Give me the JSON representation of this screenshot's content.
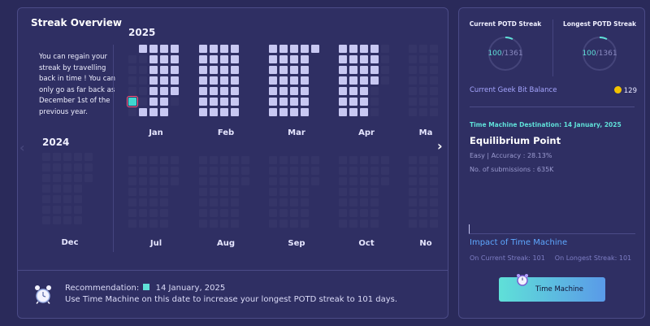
{
  "streak_overview": {
    "title": "Streak Overview",
    "info_text": "You can regain your streak by travelling back in time ! You can only go as far back as December 1st of the previous year.",
    "year_2025": "2025",
    "year_2024": "2024",
    "months_top": [
      "Jan",
      "Feb",
      "Mar",
      "Apr",
      "Ma"
    ],
    "months_bottom": [
      "Jul",
      "Aug",
      "Sep",
      "Oct",
      "No"
    ],
    "prev_month": "Dec"
  },
  "recommendation": {
    "label": "Recommendation:",
    "date": "14 January, 2025",
    "message": "Use Time Machine on this date to increase your longest POTD streak to 101 days."
  },
  "streaks": {
    "current_label": "Current POTD Streak",
    "longest_label": "Longest POTD Streak",
    "current_value": "100",
    "current_total": "/1361",
    "longest_value": "100",
    "longest_total": "/1361"
  },
  "geek_bits": {
    "label": "Current Geek Bit Balance",
    "value": "129"
  },
  "time_machine": {
    "destination": "Time Machine Destination:  14 January, 2025",
    "problem_title": "Equilibrium Point",
    "difficulty_accuracy": "Easy | Accuracy : 28.13%",
    "submissions": "No. of submissions : 635K",
    "impact_title": "Impact of Time Machine",
    "impact_current": "On Current Streak: 101",
    "impact_longest": "On Longest Streak: 101",
    "button_label": "Time Machine"
  },
  "colors": {
    "accent_teal": "#5fe0d8",
    "impact_blue": "#5ea8ff",
    "coin": "#f2c200",
    "background": "#2a2a5a"
  }
}
